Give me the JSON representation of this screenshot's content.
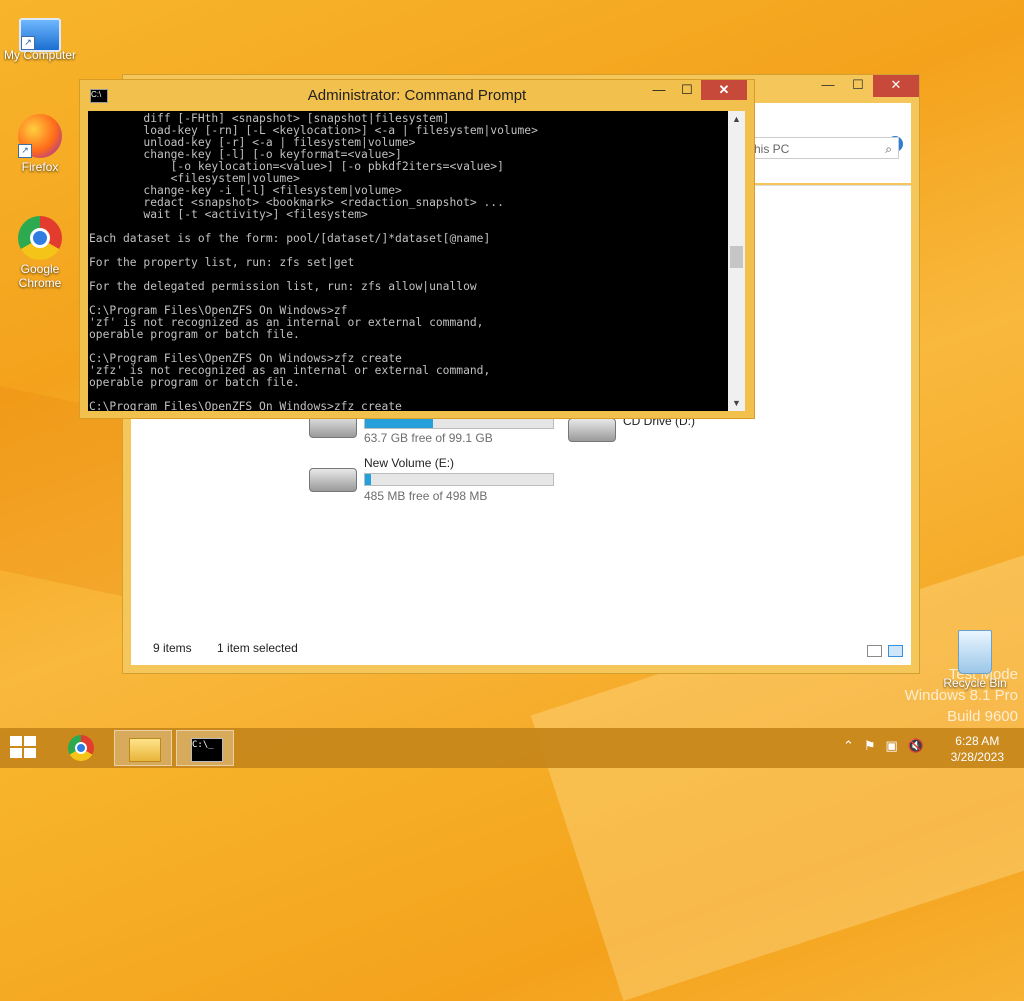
{
  "desktop": {
    "icons": [
      {
        "label": "My Computer"
      },
      {
        "label": "Firefox"
      },
      {
        "label": "Google Chrome"
      }
    ],
    "recycle_bin": "Recycle Bin",
    "watermark": [
      "Test Mode",
      "Windows 8.1 Pro",
      "Build 9600"
    ]
  },
  "explorer": {
    "search_placeholder": "his PC",
    "drives": [
      {
        "name": "CD Drive (D:)",
        "free": "",
        "fill": 0
      },
      {
        "name": "",
        "free": "63.7 GB free of 99.1 GB",
        "fill": 0.36
      },
      {
        "name": "New Volume (E:)",
        "free": "485 MB free of 498 MB",
        "fill": 0.03
      }
    ],
    "status": {
      "items": "9 items",
      "selected": "1 item selected"
    }
  },
  "cmd": {
    "title": "Administrator:  Command Prompt",
    "lines": [
      "        diff [-FHth] <snapshot> [snapshot|filesystem]",
      "        load-key [-rn] [-L <keylocation>] <-a | filesystem|volume>",
      "        unload-key [-r] <-a | filesystem|volume>",
      "        change-key [-l] [-o keyformat=<value>]",
      "            [-o keylocation=<value>] [-o pbkdf2iters=<value>]",
      "            <filesystem|volume>",
      "        change-key -i [-l] <filesystem|volume>",
      "        redact <snapshot> <bookmark> <redaction_snapshot> ...",
      "        wait [-t <activity>] <filesystem>",
      "",
      "Each dataset is of the form: pool/[dataset/]*dataset[@name]",
      "",
      "For the property list, run: zfs set|get",
      "",
      "For the delegated permission list, run: zfs allow|unallow",
      "",
      "C:\\Program Files\\OpenZFS On Windows>zf",
      "'zf' is not recognized as an internal or external command,",
      "operable program or batch file.",
      "",
      "C:\\Program Files\\OpenZFS On Windows>zfz create",
      "'zfz' is not recognized as an internal or external command,",
      "operable program or batch file.",
      "",
      "C:\\Program Files\\OpenZFS On Windows>zfz create"
    ]
  },
  "taskbar": {
    "time": "6:28 AM",
    "date": "3/28/2023"
  }
}
